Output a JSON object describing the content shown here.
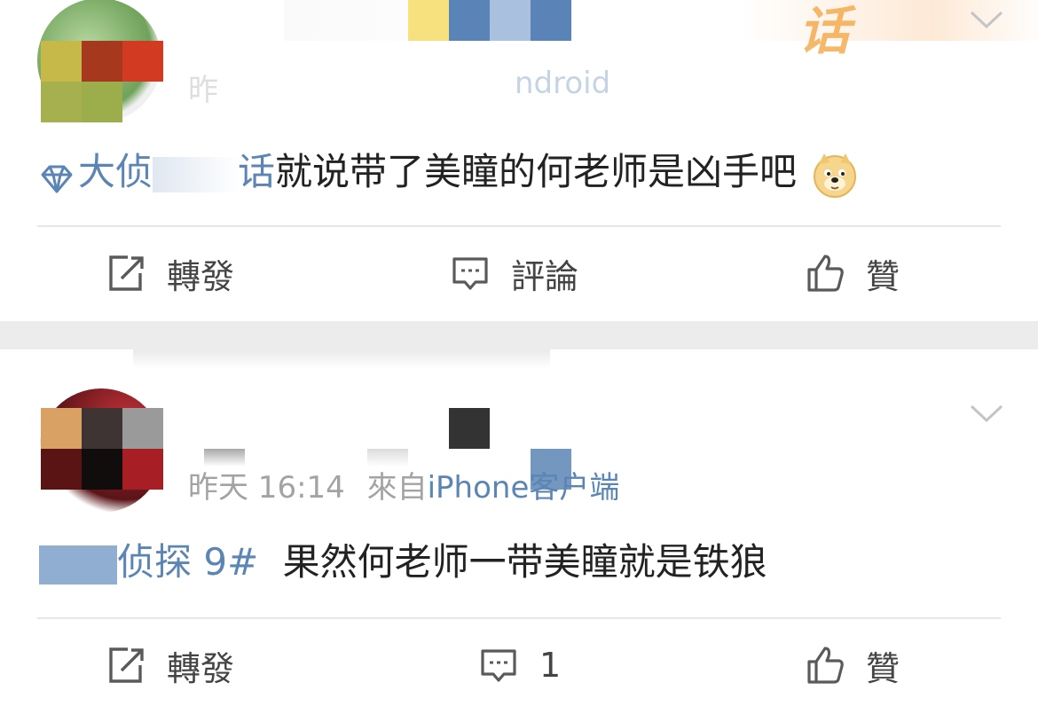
{
  "feed": {
    "posts": [
      {
        "meta_time_partial": "昨",
        "meta_source_partial": "ndroid",
        "content": {
          "topic_prefix": "大侦",
          "topic_suffix": "话",
          "text": "就说带了美瞳的何老师是凶手吧",
          "emoji": "doge-emoji"
        },
        "header_badge_partial": "话",
        "actions": {
          "repost_label": "轉發",
          "comment_label": "評論",
          "like_label": "贊"
        }
      },
      {
        "meta": {
          "time": "昨天 16:14",
          "from_label": "來自",
          "source": "iPhone客户端"
        },
        "content": {
          "topic": "侦探 9#",
          "text": "果然何老师一带美瞳就是铁狼"
        },
        "actions": {
          "repost_label": "轉發",
          "comment_count": "1",
          "like_label": "贊"
        }
      }
    ]
  },
  "colors": {
    "link_blue": "#5a85b4",
    "meta_gray": "#a3a3a3",
    "divider": "#e6e6e6",
    "gap_bg": "#ececec",
    "badge_orange": "#f2a23a"
  }
}
